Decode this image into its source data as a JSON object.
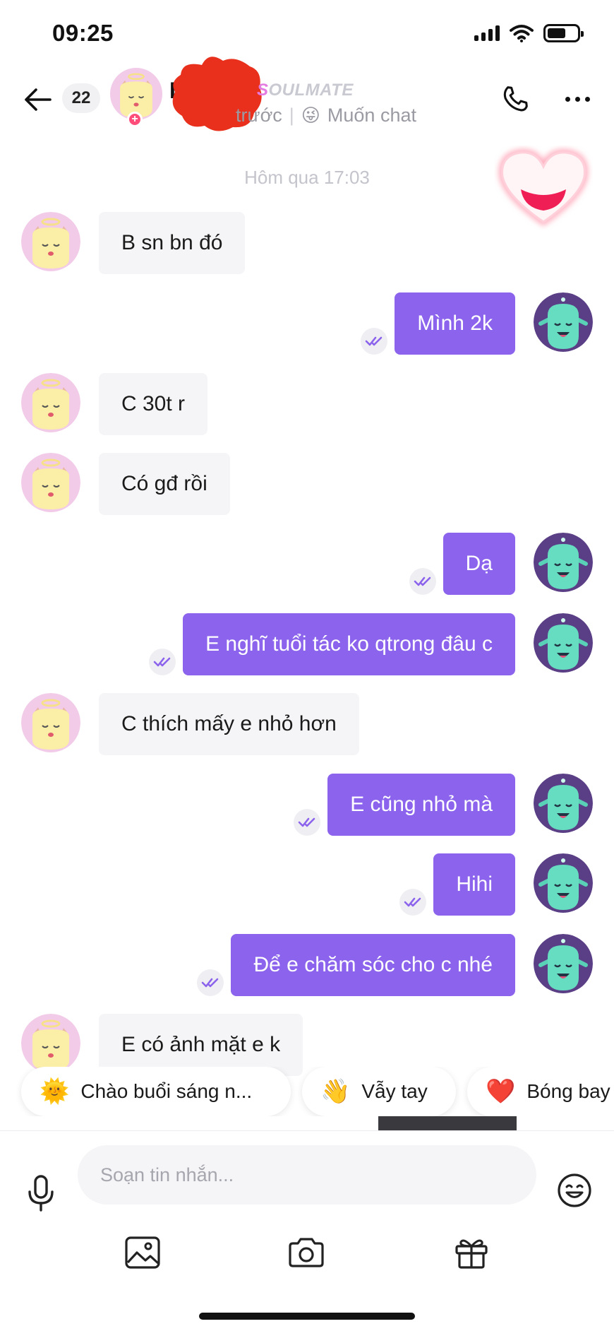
{
  "status_bar": {
    "time": "09:25",
    "battery_level": 0.62
  },
  "header": {
    "unread_count": "22",
    "contact_name": "L",
    "soulmate_tag_first": "S",
    "soulmate_tag_rest": "OULMATE",
    "last_active": "trước",
    "separator": "|",
    "mood_emoji": "😜",
    "mood_text": "Muốn chat",
    "icons": {
      "back": "arrow-left-icon",
      "call": "phone-icon",
      "more": "more-horizontal-icon",
      "add": "plus-icon"
    }
  },
  "chat": {
    "time_divider": "Hôm qua 17:03",
    "messages": [
      {
        "sender": "them",
        "text": "B sn bn đó"
      },
      {
        "sender": "me",
        "text": "Mình 2k",
        "read": true
      },
      {
        "sender": "them",
        "text": "C 30t r"
      },
      {
        "sender": "them",
        "text": "Có gđ rồi"
      },
      {
        "sender": "me",
        "text": "Dạ",
        "read": true
      },
      {
        "sender": "me",
        "text": "E nghĩ tuổi tác ko qtrong đâu c",
        "read": true
      },
      {
        "sender": "them",
        "text": "C thích mấy e nhỏ hơn"
      },
      {
        "sender": "me",
        "text": "E cũng nhỏ mà",
        "read": true
      },
      {
        "sender": "me",
        "text": "Hihi",
        "read": true
      },
      {
        "sender": "me",
        "text": "Để e chăm sóc cho c nhé",
        "read": true
      },
      {
        "sender": "them",
        "text": "E có ảnh mặt e k"
      }
    ]
  },
  "quick_replies": [
    {
      "emoji": "🌞",
      "label": "Chào buổi sáng n..."
    },
    {
      "emoji": "👋",
      "label": "Vẫy tay"
    },
    {
      "emoji": "❤️",
      "label": "Bóng bay"
    }
  ],
  "composer": {
    "placeholder": "Soạn tin nhắn...",
    "tools": [
      "image-icon",
      "camera-icon",
      "gift-icon"
    ]
  },
  "colors": {
    "outgoing_bubble": "#8b63ec",
    "incoming_bubble": "#f5f5f7",
    "accent_pink": "#e37be0"
  }
}
